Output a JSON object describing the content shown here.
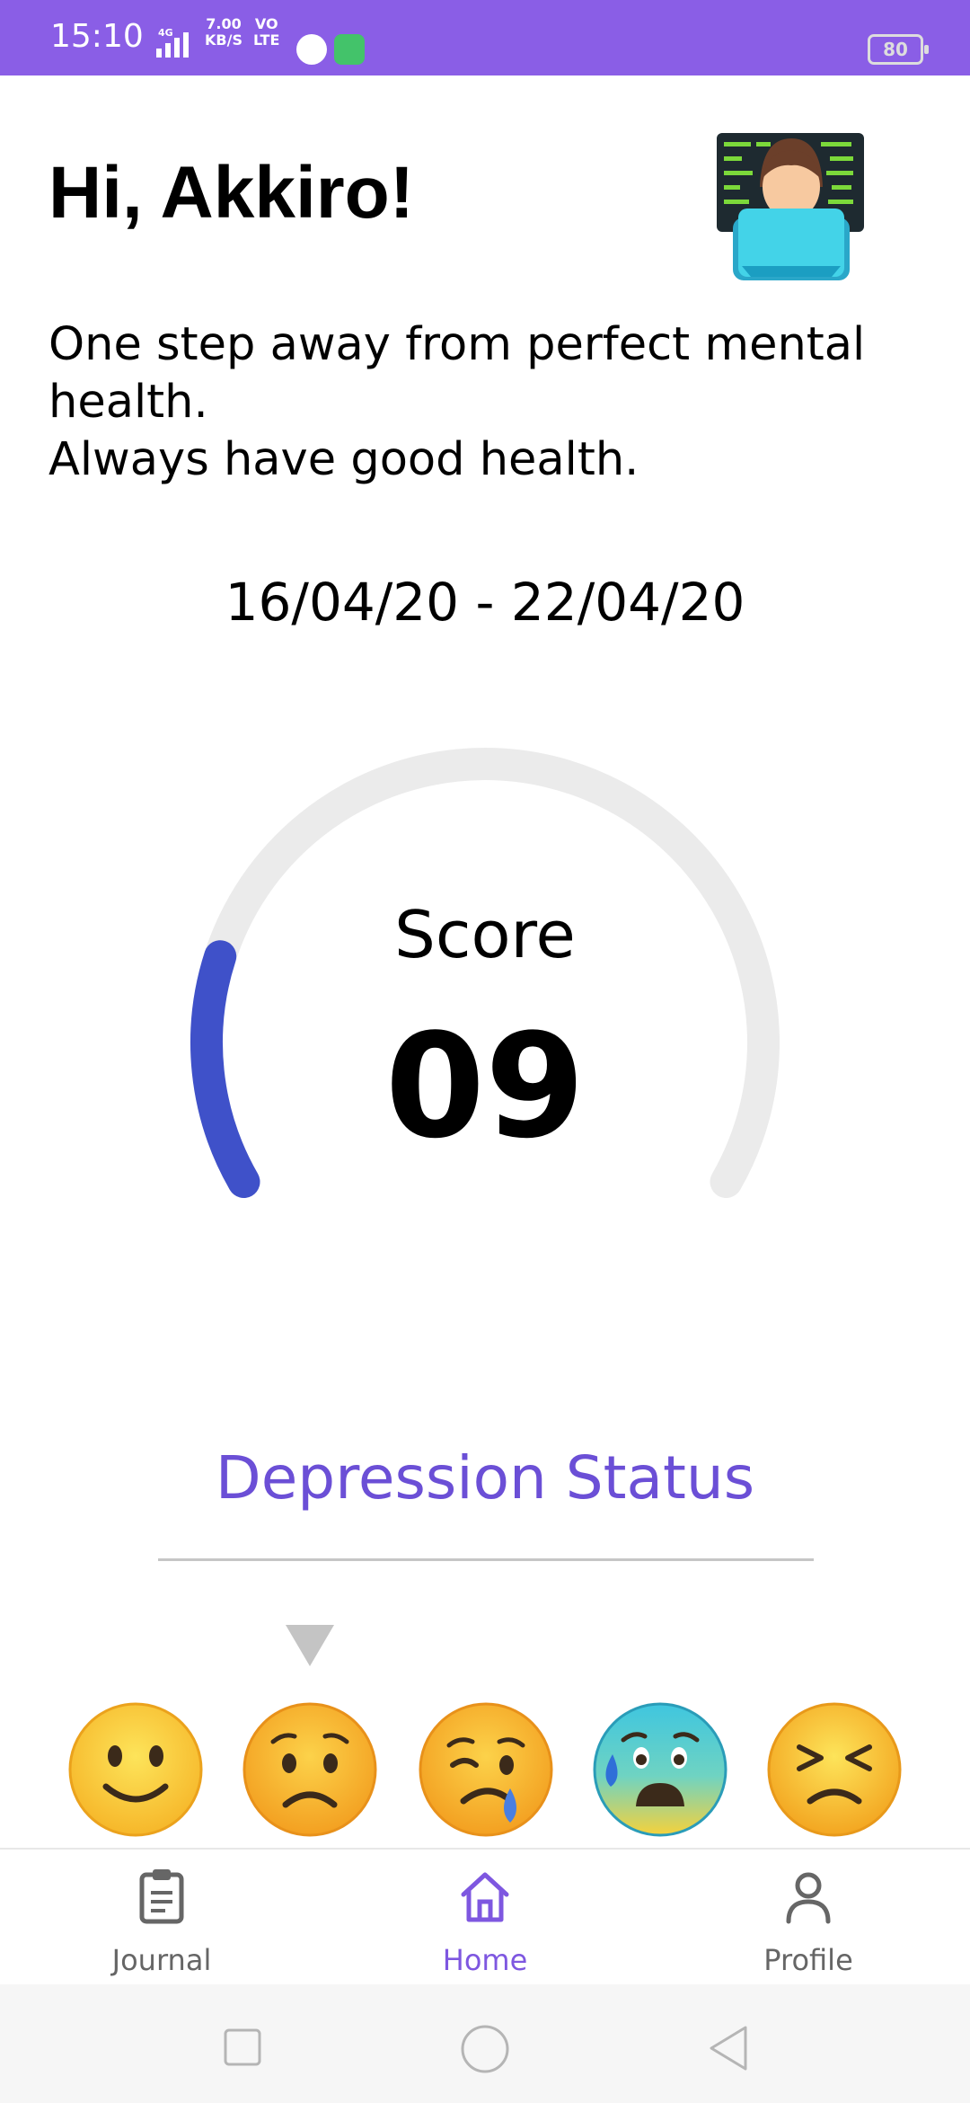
{
  "status_bar": {
    "time": "15:10",
    "net_speed_value": "7.00",
    "net_speed_unit": "KB/S",
    "network_type": "4G",
    "volte_top": "VO",
    "volte_bottom": "LTE",
    "battery": "80",
    "color": "#8a5ee6"
  },
  "header": {
    "greeting": "Hi, Akkiro!",
    "avatar_icon": "technologist-emoji"
  },
  "tagline": {
    "line1": "One step away from perfect mental",
    "line2": "health.",
    "line3": "Always have good health."
  },
  "date_range": "16/04/20 - 22/04/20",
  "score": {
    "label": "Score",
    "value": "09",
    "fill_fraction": 0.2,
    "track_color": "#ebebeb",
    "fill_color": "#3f51c9"
  },
  "depression_status": {
    "title": "Depression Status",
    "title_color": "#6b4fd6",
    "selected_index": 1,
    "levels": [
      {
        "icon": "slightly-smiling-face-emoji"
      },
      {
        "icon": "worried-face-emoji"
      },
      {
        "icon": "crying-face-emoji"
      },
      {
        "icon": "anxious-face-with-sweat-emoji"
      },
      {
        "icon": "persevering-face-emoji"
      }
    ]
  },
  "bottom_nav": {
    "items": [
      {
        "label": "Journal",
        "icon": "clipboard-icon",
        "active": false
      },
      {
        "label": "Home",
        "icon": "home-icon",
        "active": true
      },
      {
        "label": "Profile",
        "icon": "person-icon",
        "active": false
      }
    ],
    "active_color": "#7e57e0"
  },
  "system_nav": {
    "items": [
      {
        "icon": "recents-square-icon"
      },
      {
        "icon": "home-circle-icon"
      },
      {
        "icon": "back-triangle-icon"
      }
    ]
  }
}
